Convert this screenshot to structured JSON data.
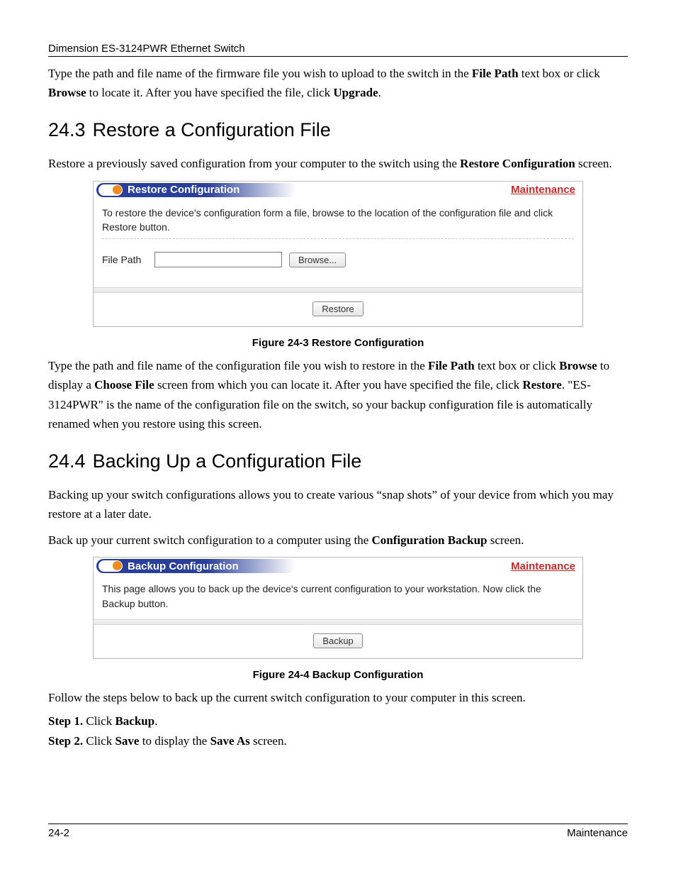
{
  "header": {
    "running": "Dimension ES-3124PWR Ethernet Switch"
  },
  "intro": {
    "p1_a": "Type the path and file name of the firmware file you wish to upload to the switch in the ",
    "p1_b": "File Path",
    "p1_c": " text box or click ",
    "p1_d": "Browse",
    "p1_e": " to locate it. After you have specified the file, click ",
    "p1_f": "Upgrade",
    "p1_g": "."
  },
  "section_restore": {
    "num": "24.3",
    "title": "Restore a Configuration File",
    "p1_a": "Restore a previously saved configuration from your computer to the switch using the ",
    "p1_b": "Restore Configuration",
    "p1_c": " screen.",
    "caption": "Figure 24-3 Restore Configuration",
    "p2_a": "Type the path and file name of the configuration file you wish to restore in the ",
    "p2_b": "File Path",
    "p2_c": " text box or click ",
    "p2_d": "Browse",
    "p2_e": " to display a ",
    "p2_f": "Choose File",
    "p2_g": " screen from which you can locate it. After you have specified the file, click ",
    "p2_h": "Restore",
    "p2_i": ". \"ES-3124PWR\" is the name of the configuration file on the switch, so your backup configuration file is automatically renamed when you restore using this screen."
  },
  "panel_restore": {
    "title": "Restore Configuration",
    "link": "Maintenance",
    "desc": "To restore the device's configuration form a file, browse to the location of the configuration file and click Restore button.",
    "file_label": "File Path",
    "browse": "Browse...",
    "submit": "Restore"
  },
  "section_backup": {
    "num": "24.4",
    "title": "Backing Up a Configuration File",
    "p1": "Backing up your switch configurations allows you to create various “snap shots” of your device from which you may restore at a later date.",
    "p2_a": "Back up your current switch configuration to a computer using the ",
    "p2_b": "Configuration Backup",
    "p2_c": " screen.",
    "caption": "Figure 24-4 Backup Configuration",
    "p3": "Follow the steps below to back up the current switch configuration to your computer in this screen."
  },
  "panel_backup": {
    "title": "Backup Configuration",
    "link": "Maintenance",
    "desc": "This page allows you to back up the device's current configuration to your workstation. Now click the Backup button.",
    "submit": "Backup"
  },
  "steps": {
    "s1_label": "Step 1.",
    "s1_a": " Click ",
    "s1_b": "Backup",
    "s1_c": ".",
    "s2_label": "Step 2.",
    "s2_a": " Click ",
    "s2_b": "Save",
    "s2_c": " to display the ",
    "s2_d": "Save As",
    "s2_e": " screen."
  },
  "footer": {
    "left": "24-2",
    "right": "Maintenance"
  }
}
